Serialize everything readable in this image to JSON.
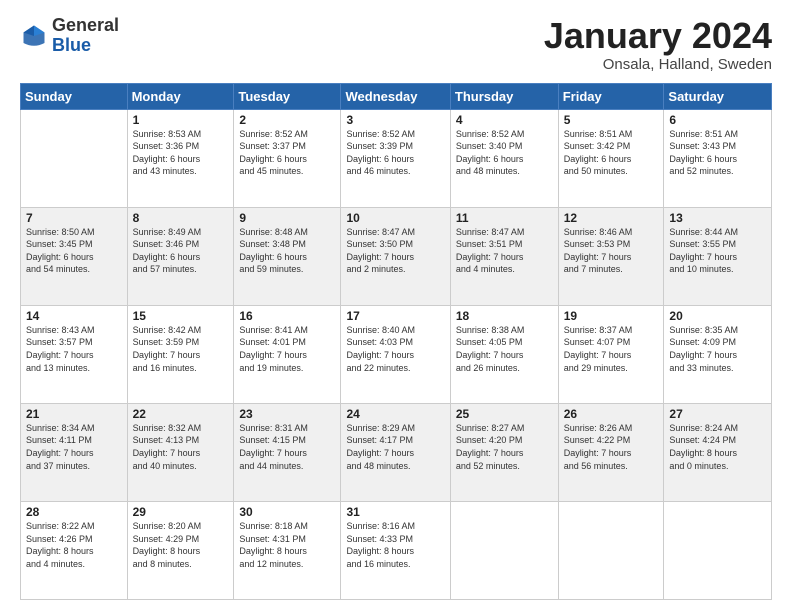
{
  "logo": {
    "line1": "General",
    "line2": "Blue"
  },
  "header": {
    "title": "January 2024",
    "subtitle": "Onsala, Halland, Sweden"
  },
  "days_of_week": [
    "Sunday",
    "Monday",
    "Tuesday",
    "Wednesday",
    "Thursday",
    "Friday",
    "Saturday"
  ],
  "weeks": [
    [
      {
        "day": "",
        "info": ""
      },
      {
        "day": "1",
        "info": "Sunrise: 8:53 AM\nSunset: 3:36 PM\nDaylight: 6 hours\nand 43 minutes."
      },
      {
        "day": "2",
        "info": "Sunrise: 8:52 AM\nSunset: 3:37 PM\nDaylight: 6 hours\nand 45 minutes."
      },
      {
        "day": "3",
        "info": "Sunrise: 8:52 AM\nSunset: 3:39 PM\nDaylight: 6 hours\nand 46 minutes."
      },
      {
        "day": "4",
        "info": "Sunrise: 8:52 AM\nSunset: 3:40 PM\nDaylight: 6 hours\nand 48 minutes."
      },
      {
        "day": "5",
        "info": "Sunrise: 8:51 AM\nSunset: 3:42 PM\nDaylight: 6 hours\nand 50 minutes."
      },
      {
        "day": "6",
        "info": "Sunrise: 8:51 AM\nSunset: 3:43 PM\nDaylight: 6 hours\nand 52 minutes."
      }
    ],
    [
      {
        "day": "7",
        "info": "Sunrise: 8:50 AM\nSunset: 3:45 PM\nDaylight: 6 hours\nand 54 minutes."
      },
      {
        "day": "8",
        "info": "Sunrise: 8:49 AM\nSunset: 3:46 PM\nDaylight: 6 hours\nand 57 minutes."
      },
      {
        "day": "9",
        "info": "Sunrise: 8:48 AM\nSunset: 3:48 PM\nDaylight: 6 hours\nand 59 minutes."
      },
      {
        "day": "10",
        "info": "Sunrise: 8:47 AM\nSunset: 3:50 PM\nDaylight: 7 hours\nand 2 minutes."
      },
      {
        "day": "11",
        "info": "Sunrise: 8:47 AM\nSunset: 3:51 PM\nDaylight: 7 hours\nand 4 minutes."
      },
      {
        "day": "12",
        "info": "Sunrise: 8:46 AM\nSunset: 3:53 PM\nDaylight: 7 hours\nand 7 minutes."
      },
      {
        "day": "13",
        "info": "Sunrise: 8:44 AM\nSunset: 3:55 PM\nDaylight: 7 hours\nand 10 minutes."
      }
    ],
    [
      {
        "day": "14",
        "info": "Sunrise: 8:43 AM\nSunset: 3:57 PM\nDaylight: 7 hours\nand 13 minutes."
      },
      {
        "day": "15",
        "info": "Sunrise: 8:42 AM\nSunset: 3:59 PM\nDaylight: 7 hours\nand 16 minutes."
      },
      {
        "day": "16",
        "info": "Sunrise: 8:41 AM\nSunset: 4:01 PM\nDaylight: 7 hours\nand 19 minutes."
      },
      {
        "day": "17",
        "info": "Sunrise: 8:40 AM\nSunset: 4:03 PM\nDaylight: 7 hours\nand 22 minutes."
      },
      {
        "day": "18",
        "info": "Sunrise: 8:38 AM\nSunset: 4:05 PM\nDaylight: 7 hours\nand 26 minutes."
      },
      {
        "day": "19",
        "info": "Sunrise: 8:37 AM\nSunset: 4:07 PM\nDaylight: 7 hours\nand 29 minutes."
      },
      {
        "day": "20",
        "info": "Sunrise: 8:35 AM\nSunset: 4:09 PM\nDaylight: 7 hours\nand 33 minutes."
      }
    ],
    [
      {
        "day": "21",
        "info": "Sunrise: 8:34 AM\nSunset: 4:11 PM\nDaylight: 7 hours\nand 37 minutes."
      },
      {
        "day": "22",
        "info": "Sunrise: 8:32 AM\nSunset: 4:13 PM\nDaylight: 7 hours\nand 40 minutes."
      },
      {
        "day": "23",
        "info": "Sunrise: 8:31 AM\nSunset: 4:15 PM\nDaylight: 7 hours\nand 44 minutes."
      },
      {
        "day": "24",
        "info": "Sunrise: 8:29 AM\nSunset: 4:17 PM\nDaylight: 7 hours\nand 48 minutes."
      },
      {
        "day": "25",
        "info": "Sunrise: 8:27 AM\nSunset: 4:20 PM\nDaylight: 7 hours\nand 52 minutes."
      },
      {
        "day": "26",
        "info": "Sunrise: 8:26 AM\nSunset: 4:22 PM\nDaylight: 7 hours\nand 56 minutes."
      },
      {
        "day": "27",
        "info": "Sunrise: 8:24 AM\nSunset: 4:24 PM\nDaylight: 8 hours\nand 0 minutes."
      }
    ],
    [
      {
        "day": "28",
        "info": "Sunrise: 8:22 AM\nSunset: 4:26 PM\nDaylight: 8 hours\nand 4 minutes."
      },
      {
        "day": "29",
        "info": "Sunrise: 8:20 AM\nSunset: 4:29 PM\nDaylight: 8 hours\nand 8 minutes."
      },
      {
        "day": "30",
        "info": "Sunrise: 8:18 AM\nSunset: 4:31 PM\nDaylight: 8 hours\nand 12 minutes."
      },
      {
        "day": "31",
        "info": "Sunrise: 8:16 AM\nSunset: 4:33 PM\nDaylight: 8 hours\nand 16 minutes."
      },
      {
        "day": "",
        "info": ""
      },
      {
        "day": "",
        "info": ""
      },
      {
        "day": "",
        "info": ""
      }
    ]
  ]
}
